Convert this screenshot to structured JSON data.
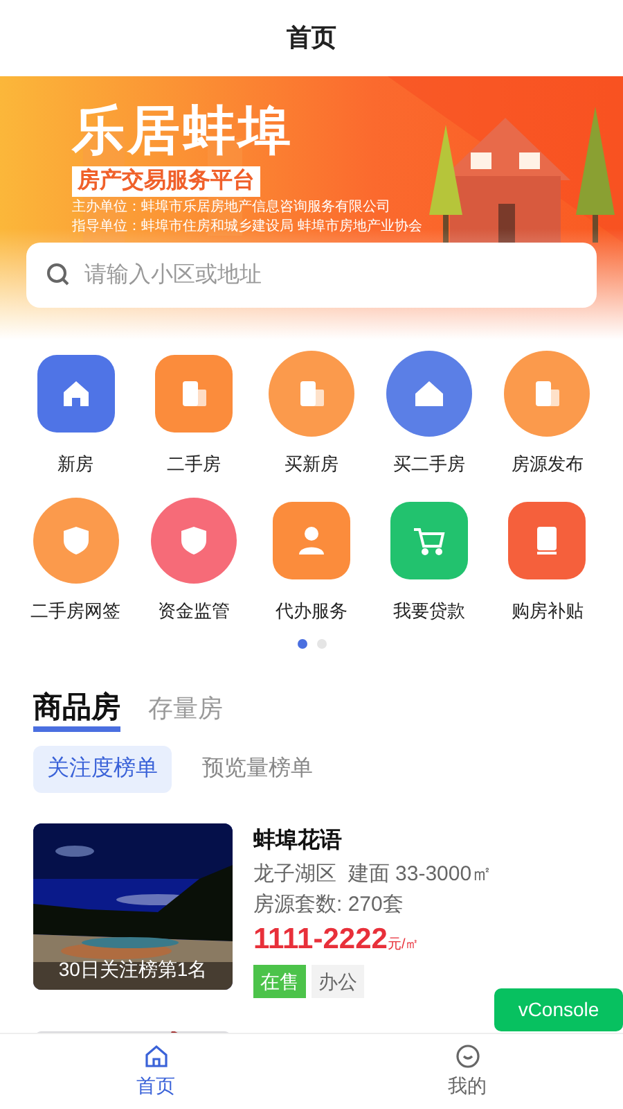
{
  "header": {
    "title": "首页"
  },
  "banner": {
    "kind": "picture",
    "title": "乐居蚌埠",
    "subtitle": "房产交易服务平台",
    "lines": [
      "主办单位：蚌埠市乐居房地产信息咨询服务有限公司",
      "指导单位：蚌埠市住房和城乡建设局 蚌埠市房地产业协会"
    ]
  },
  "search": {
    "placeholder": "请输入小区或地址"
  },
  "shortcuts": [
    {
      "label": "新房",
      "kind": "square",
      "color": "#4f74e6"
    },
    {
      "label": "二手房",
      "kind": "square",
      "color": "#fb8c3c"
    },
    {
      "label": "买新房",
      "kind": "circle",
      "color": "#fb9a4c"
    },
    {
      "label": "买二手房",
      "kind": "circle",
      "color": "#5b7fe6"
    },
    {
      "label": "房源发布",
      "kind": "circle",
      "color": "#fb9a4c"
    },
    {
      "label": "二手房网签",
      "kind": "circle",
      "color": "#fb9a4c"
    },
    {
      "label": "资金监管",
      "kind": "circle",
      "color": "#f66b78"
    },
    {
      "label": "代办服务",
      "kind": "square",
      "color": "#fb8c3c"
    },
    {
      "label": "我要贷款",
      "kind": "square",
      "color": "#22c26e"
    },
    {
      "label": "购房补贴",
      "kind": "square",
      "color": "#f5603c"
    }
  ],
  "pager": [
    {
      "selected": true
    },
    {
      "selected": false
    }
  ],
  "category_tabs": [
    {
      "label": "商品房",
      "selected": true
    },
    {
      "label": "存量房",
      "selected": false
    }
  ],
  "ranking_tabs": [
    {
      "label": "关注度榜单",
      "selected": true
    },
    {
      "label": "预览量榜单",
      "selected": false
    }
  ],
  "listings": [
    {
      "kind": "full",
      "badge": "30日关注榜第1名",
      "name": "蚌埠花语",
      "district": "龙子湖区",
      "area": "建面 33-3000㎡",
      "count": "房源套数: 270套",
      "price": "1111-2222",
      "unit": "元/㎡",
      "tags": [
        {
          "label": "在售",
          "kind": "status"
        },
        {
          "label": "办公",
          "kind": "type"
        }
      ]
    },
    {
      "kind": "picture"
    }
  ],
  "floating_button": {
    "label": "vConsole"
  },
  "bottom_nav": [
    {
      "label": "首页",
      "selected": true
    },
    {
      "label": "我的",
      "selected": false
    }
  ]
}
